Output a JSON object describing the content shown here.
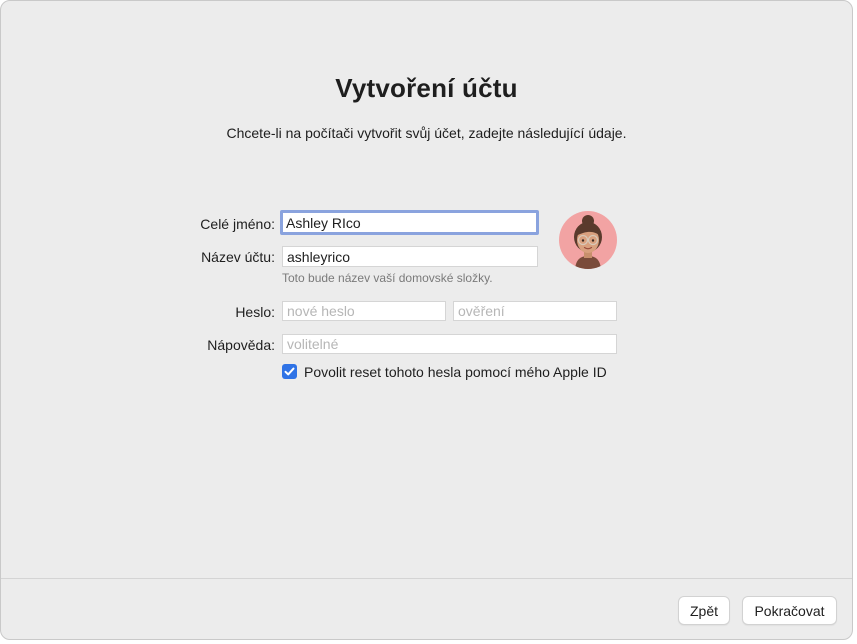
{
  "title": "Vytvoření účtu",
  "subtitle": "Chcete-li na počítači vytvořit svůj účet, zadejte následující údaje.",
  "form": {
    "full_name": {
      "label": "Celé jméno:",
      "value": "Ashley RIco"
    },
    "account_name": {
      "label": "Název účtu:",
      "value": "ashleyrico",
      "hint": "Toto bude název vaší domovské složky."
    },
    "password": {
      "label": "Heslo:",
      "placeholder": "nové heslo",
      "verify_placeholder": "ověření"
    },
    "hint_field": {
      "label": "Nápověda:",
      "placeholder": "volitelné"
    },
    "allow_reset": {
      "label": "Povolit reset tohoto hesla pomocí mého Apple ID",
      "checked": true
    }
  },
  "avatar": {
    "icon": "memoji-avatar",
    "background": "#f2a3a3"
  },
  "buttons": {
    "back": "Zpět",
    "continue": "Pokračovat"
  },
  "colors": {
    "accent": "#2f73e6",
    "focus_ring": "#8aa3de",
    "window_bg": "#ececec"
  }
}
